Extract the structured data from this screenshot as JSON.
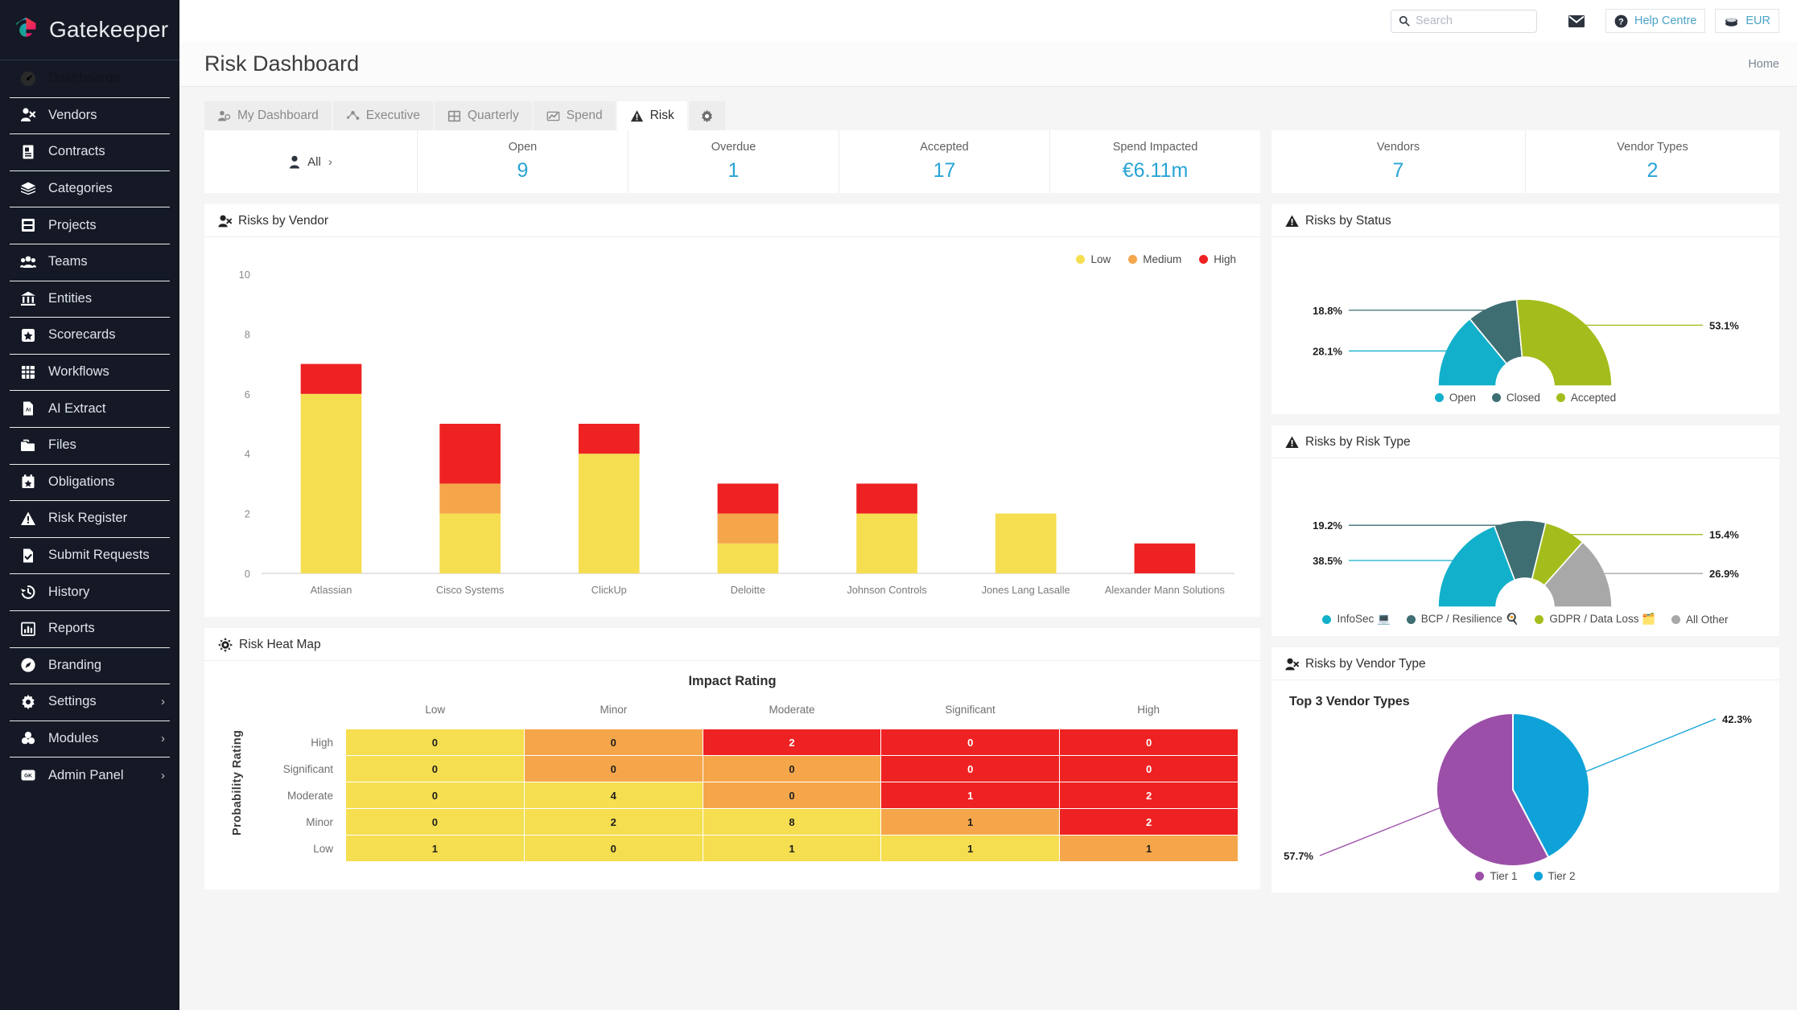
{
  "brand": {
    "name": "Gatekeeper"
  },
  "sidebar": {
    "items": [
      {
        "label": "Dashboards",
        "icon": "gauge-icon",
        "chevron": "",
        "active": true
      },
      {
        "label": "Vendors",
        "icon": "vendor-icon",
        "chevron": ""
      },
      {
        "label": "Contracts",
        "icon": "contract-icon",
        "chevron": ""
      },
      {
        "label": "Categories",
        "icon": "layers-icon",
        "chevron": ""
      },
      {
        "label": "Projects",
        "icon": "archive-icon",
        "chevron": ""
      },
      {
        "label": "Teams",
        "icon": "people-icon",
        "chevron": ""
      },
      {
        "label": "Entities",
        "icon": "bank-icon",
        "chevron": ""
      },
      {
        "label": "Scorecards",
        "icon": "star-card-icon",
        "chevron": ""
      },
      {
        "label": "Workflows",
        "icon": "grid-icon",
        "chevron": ""
      },
      {
        "label": "AI Extract",
        "icon": "ai-doc-icon",
        "chevron": ""
      },
      {
        "label": "Files",
        "icon": "folder-icon",
        "chevron": ""
      },
      {
        "label": "Obligations",
        "icon": "calendar-star-icon",
        "chevron": ""
      },
      {
        "label": "Risk Register",
        "icon": "warning-icon",
        "chevron": ""
      },
      {
        "label": "Submit Requests",
        "icon": "doc-check-icon",
        "chevron": ""
      },
      {
        "label": "History",
        "icon": "history-icon",
        "chevron": ""
      },
      {
        "label": "Reports",
        "icon": "bars-icon",
        "chevron": ""
      },
      {
        "label": "Branding",
        "icon": "palette-icon",
        "chevron": ""
      },
      {
        "label": "Settings",
        "icon": "gear-icon",
        "chevron": "›"
      },
      {
        "label": "Modules",
        "icon": "modules-icon",
        "chevron": "›"
      },
      {
        "label": "Admin Panel",
        "icon": "gk-badge-icon",
        "chevron": "›"
      }
    ]
  },
  "topbar": {
    "search_placeholder": "Search",
    "help_label": "Help Centre",
    "currency_label": "EUR"
  },
  "header": {
    "title": "Risk Dashboard",
    "home_link": "Home"
  },
  "tabs": [
    {
      "label": "My Dashboard",
      "icon": "people-small-icon",
      "active": false
    },
    {
      "label": "Executive",
      "icon": "network-icon",
      "active": false
    },
    {
      "label": "Quarterly",
      "icon": "table-icon",
      "active": false
    },
    {
      "label": "Spend",
      "icon": "trend-icon",
      "active": false
    },
    {
      "label": "Risk",
      "icon": "warning-icon",
      "active": true
    },
    {
      "label": "",
      "icon": "gear-icon",
      "active": false
    }
  ],
  "kpis": {
    "filter_label": "All",
    "left": [
      {
        "label": "Open",
        "value": "9"
      },
      {
        "label": "Overdue",
        "value": "1"
      },
      {
        "label": "Accepted",
        "value": "17"
      },
      {
        "label": "Spend Impacted",
        "value": "€6.11m"
      }
    ],
    "right": [
      {
        "label": "Vendors",
        "value": "7"
      },
      {
        "label": "Vendor Types",
        "value": "2"
      }
    ]
  },
  "panels": {
    "risks_by_vendor": {
      "title": "Risks by Vendor",
      "icon": "vendor-icon"
    },
    "risk_heat_map": {
      "title": "Risk Heat Map",
      "icon": "sun-gear-icon"
    },
    "risks_by_status": {
      "title": "Risks by Status",
      "icon": "warning-icon"
    },
    "risks_by_risk_type": {
      "title": "Risks by Risk Type",
      "icon": "warning-icon"
    },
    "risks_by_vendor_type": {
      "title": "Risks by Vendor Type",
      "icon": "vendor-icon",
      "subtitle": "Top 3 Vendor Types"
    }
  },
  "colors": {
    "low": "#F5DE50",
    "medium": "#F5A64B",
    "high": "#EE2222",
    "open": "#12B0CB",
    "closed": "#3E6E72",
    "accepted": "#A5BD1C",
    "all_other": "#A8A8A8",
    "tier1": "#9B4FA8",
    "tier2": "#0FA2D8",
    "accent": "#27a4d4"
  },
  "chart_data": [
    {
      "type": "bar",
      "title": "Risks by Vendor",
      "stacked": true,
      "categories": [
        "Atlassian",
        "Cisco Systems",
        "ClickUp",
        "Deloitte",
        "Johnson Controls",
        "Jones Lang Lasalle",
        "Alexander Mann Solutions"
      ],
      "series": [
        {
          "name": "Low",
          "color": "#F5DE50",
          "values": [
            6,
            2,
            4,
            1,
            2,
            2,
            0
          ]
        },
        {
          "name": "Medium",
          "color": "#F5A64B",
          "values": [
            0,
            1,
            0,
            1,
            0,
            0,
            0
          ]
        },
        {
          "name": "High",
          "color": "#EE2222",
          "values": [
            1,
            2,
            1,
            1,
            1,
            0,
            1
          ]
        }
      ],
      "ylim": [
        0,
        10
      ],
      "yticks": [
        0,
        2,
        4,
        6,
        8,
        10
      ],
      "xlabel": "",
      "ylabel": "",
      "grid": false,
      "legend_position": "top-right"
    },
    {
      "type": "pie",
      "title": "Risks by Status",
      "variant": "half-donut",
      "labels": [
        "Open",
        "Closed",
        "Accepted"
      ],
      "values": [
        28.1,
        18.8,
        53.1
      ],
      "value_labels": [
        "28.1%",
        "18.8%",
        "53.1%"
      ],
      "colors": [
        "#12B0CB",
        "#3E6E72",
        "#A5BD1C"
      ],
      "legend_position": "bottom"
    },
    {
      "type": "pie",
      "title": "Risks by Risk Type",
      "variant": "half-donut",
      "labels": [
        "InfoSec 💻",
        "BCP / Resilience 🍳",
        "GDPR / Data Loss 🗂️",
        "All Other"
      ],
      "values": [
        38.5,
        19.2,
        15.4,
        26.9
      ],
      "value_labels": [
        "38.5%",
        "19.2%",
        "15.4%",
        "26.9%"
      ],
      "colors": [
        "#12B0CB",
        "#3E6E72",
        "#A5BD1C",
        "#A8A8A8"
      ],
      "legend_position": "bottom"
    },
    {
      "type": "pie",
      "title": "Risks by Vendor Type",
      "subtitle": "Top 3 Vendor Types",
      "variant": "pie",
      "labels": [
        "Tier 1",
        "Tier 2"
      ],
      "values": [
        57.7,
        42.3
      ],
      "value_labels": [
        "57.7%",
        "42.3%"
      ],
      "colors": [
        "#9B4FA8",
        "#0FA2D8"
      ],
      "legend_position": "bottom"
    },
    {
      "type": "heatmap",
      "title": "Risk Heat Map",
      "xlabel": "Impact Rating",
      "ylabel": "Probability Rating",
      "columns": [
        "Low",
        "Minor",
        "Moderate",
        "Significant",
        "High"
      ],
      "rows": [
        "High",
        "Significant",
        "Moderate",
        "Minor",
        "Low"
      ],
      "values": [
        [
          0,
          0,
          2,
          0,
          0
        ],
        [
          0,
          0,
          0,
          0,
          0
        ],
        [
          0,
          4,
          0,
          1,
          2
        ],
        [
          0,
          2,
          8,
          1,
          2
        ],
        [
          1,
          0,
          1,
          1,
          1
        ]
      ],
      "cell_colors": [
        [
          "#F5DE50",
          "#F5A64B",
          "#EE2222",
          "#EE2222",
          "#EE2222"
        ],
        [
          "#F5DE50",
          "#F5A64B",
          "#F5A64B",
          "#EE2222",
          "#EE2222"
        ],
        [
          "#F5DE50",
          "#F5DE50",
          "#F5A64B",
          "#EE2222",
          "#EE2222"
        ],
        [
          "#F5DE50",
          "#F5DE50",
          "#F5DE50",
          "#F5A64B",
          "#EE2222"
        ],
        [
          "#F5DE50",
          "#F5DE50",
          "#F5DE50",
          "#F5DE50",
          "#F5A64B"
        ]
      ]
    }
  ]
}
